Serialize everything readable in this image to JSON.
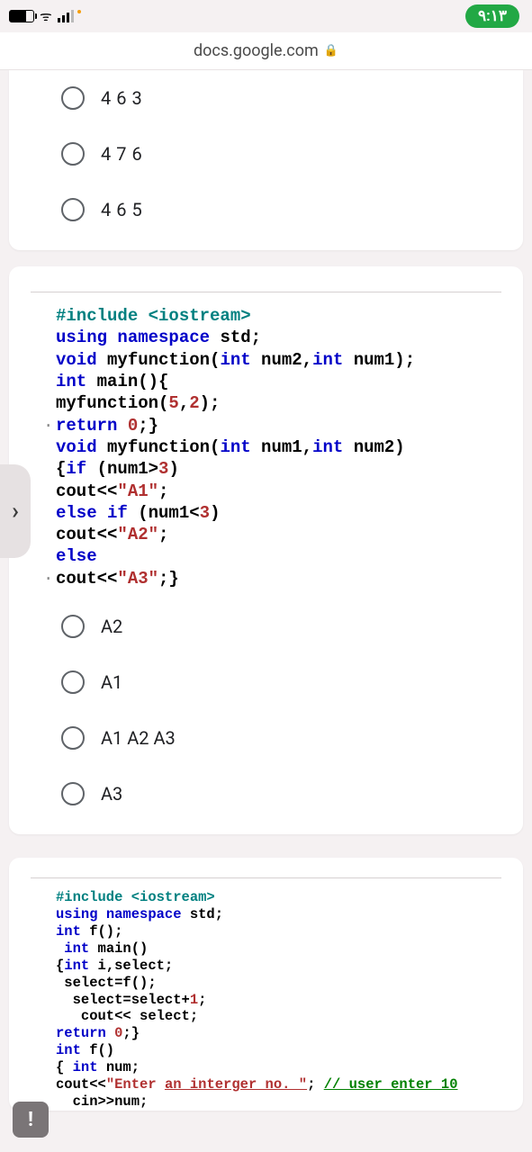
{
  "status": {
    "clock": "۹:۱۳"
  },
  "url": "docs.google.com",
  "q1": {
    "options": [
      "463",
      "476",
      "465"
    ]
  },
  "q2": {
    "code": {
      "l1a": "#include",
      "l1b": " <iostream>",
      "l2a": "using",
      "l2b": " namespace",
      "l2c": " std;",
      "l3a": "void",
      "l3b": " myfunction(",
      "l3c": "int",
      "l3d": " num2,",
      "l3e": "int",
      "l3f": " num1);",
      "l4a": "int",
      "l4b": " main(){",
      "l5a": "myfunction(",
      "l5b": "5",
      "l5c": ",",
      "l5d": "2",
      "l5e": ");",
      "l6a": "return",
      "l6b": " 0",
      "l6c": ";}",
      "l7a": "void",
      "l7b": " myfunction(",
      "l7c": "int",
      "l7d": " num1,",
      "l7e": "int",
      "l7f": " num2)",
      "l8a": "{",
      "l8b": "if",
      "l8c": " (num1>",
      "l8d": "3",
      "l8e": ")",
      "l9a": "cout<<",
      "l9b": "\"A1\"",
      "l9c": ";",
      "l10a": "else",
      "l10b": " if",
      "l10c": " (num1<",
      "l10d": "3",
      "l10e": ")",
      "l11a": "cout<<",
      "l11b": "\"A2\"",
      "l11c": ";",
      "l12": "else",
      "l13a": "cout<<",
      "l13b": "\"A3\"",
      "l13c": ";}"
    },
    "options": [
      "A2",
      "A1",
      "A1 A2 A3",
      "A3"
    ]
  },
  "q3": {
    "code": {
      "l1a": "#include",
      "l1b": " <iostream>",
      "l2a": "using",
      "l2b": " namespace",
      "l2c": " std;",
      "l3a": "int",
      "l3b": " f();",
      "l4a": " int",
      "l4b": " main()",
      "l5a": "{int",
      "l5b": " i,select;",
      "l6": " select=f();",
      "l7a": "  select=select+",
      "l7b": "1",
      "l7c": ";",
      "l8": "   cout<< select;",
      "l9a": "return",
      "l9b": " 0",
      "l9c": ";}",
      "l10a": "int",
      "l10b": " f()",
      "l11a": "{ ",
      "l11b": "int",
      "l11c": " num;",
      "l12a": "cout<<",
      "l12b": "\"Enter ",
      "l12c": "an interger no. \"",
      "l12d": "; ",
      "l12e": "// user enter 10",
      "l13": "  cin>>num;"
    }
  },
  "sidetab": "›",
  "fab": "!"
}
